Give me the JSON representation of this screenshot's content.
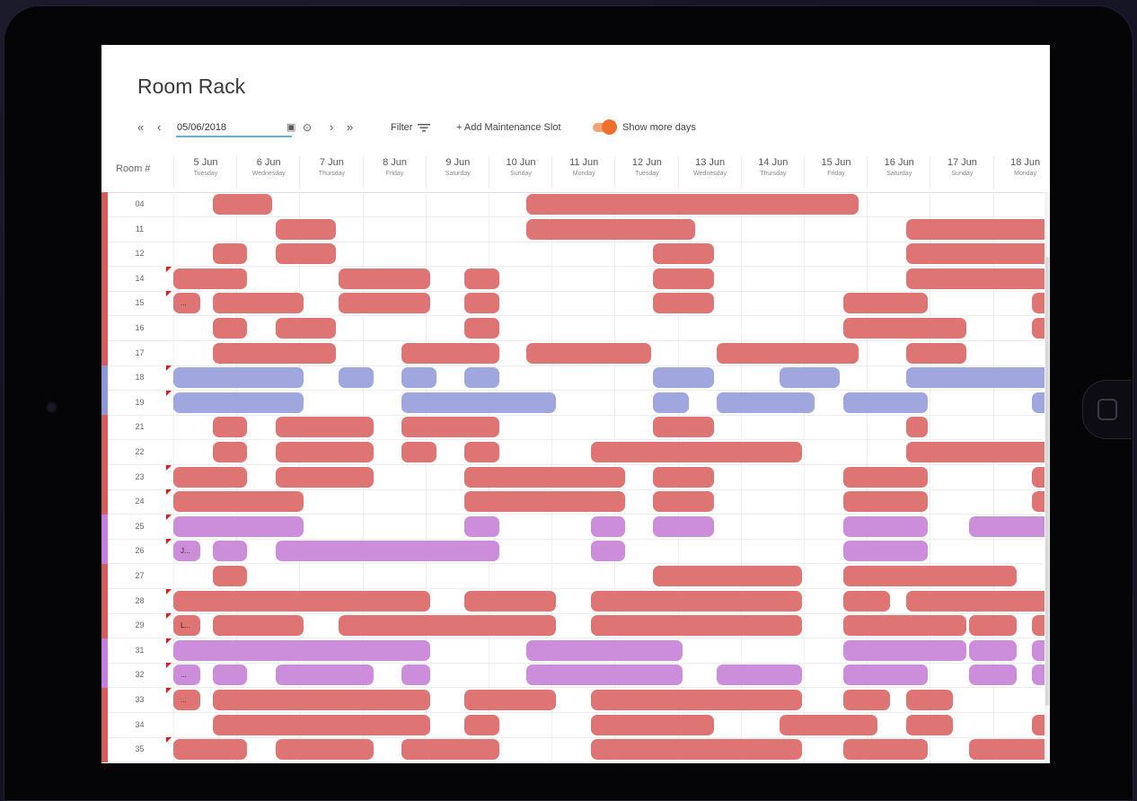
{
  "title": "Room Rack",
  "toolbar": {
    "first_icon": "«",
    "prev_icon": "‹",
    "date_value": "05/06/2018",
    "calendar_icon": "▣",
    "today_icon": "⊙",
    "next_icon": "›",
    "last_icon": "»",
    "filter_label": "Filter",
    "filter_icon": "filter-lines-icon",
    "add_label": "+ Add Maintenance Slot",
    "toggle_on": true,
    "toggle_label": "Show more days",
    "toggle_color": "#ef6f2c"
  },
  "table": {
    "room_header": "Room #",
    "days": [
      {
        "date": "5 Jun",
        "weekday": "Tuesday"
      },
      {
        "date": "6 Jun",
        "weekday": "Wednesday"
      },
      {
        "date": "7 Jun",
        "weekday": "Thursday"
      },
      {
        "date": "8 Jun",
        "weekday": "Friday"
      },
      {
        "date": "9 Jun",
        "weekday": "Saturday"
      },
      {
        "date": "10 Jun",
        "weekday": "Sunday"
      },
      {
        "date": "11 Jun",
        "weekday": "Monday"
      },
      {
        "date": "12 Jun",
        "weekday": "Tuesday"
      },
      {
        "date": "13 Jun",
        "weekday": "Wednesday"
      },
      {
        "date": "14 Jun",
        "weekday": "Thursday"
      },
      {
        "date": "15 Jun",
        "weekday": "Friday"
      },
      {
        "date": "16 Jun",
        "weekday": "Saturday"
      },
      {
        "date": "17 Jun",
        "weekday": "Sunday"
      },
      {
        "date": "18 Jun",
        "weekday": "Monday"
      }
    ]
  },
  "colors": {
    "red": "#df7474",
    "blue": "#a0a6de",
    "purple": "#cc8edb",
    "flag": "#e01a1a",
    "accent": "#5ab4d9"
  },
  "rooms": [
    {
      "no": "04",
      "type": "red",
      "flag": false,
      "bars": [
        [
          0.62,
          1.6
        ],
        [
          5.6,
          8.1
        ],
        [
          7.4,
          10.9
        ]
      ]
    },
    {
      "no": "11",
      "type": "red",
      "flag": false,
      "bars": [
        [
          1.62,
          2.6
        ],
        [
          5.6,
          8.3
        ],
        [
          11.62,
          14.1
        ]
      ]
    },
    {
      "no": "12",
      "type": "red",
      "flag": false,
      "bars": [
        [
          0.62,
          1.2
        ],
        [
          1.62,
          2.6
        ],
        [
          7.6,
          8.6
        ],
        [
          11.62,
          14.1
        ]
      ]
    },
    {
      "no": "14",
      "type": "red",
      "flag": true,
      "bars": [
        [
          0,
          1.2
        ],
        [
          2.62,
          4.1
        ],
        [
          4.62,
          5.2
        ],
        [
          7.6,
          8.6
        ],
        [
          11.62,
          14.1
        ]
      ]
    },
    {
      "no": "15",
      "type": "red",
      "flag": true,
      "bars": [
        [
          0,
          0.45,
          "..."
        ],
        [
          0.62,
          2.1
        ],
        [
          2.62,
          4.1
        ],
        [
          4.62,
          5.2
        ],
        [
          7.6,
          8.6
        ],
        [
          10.62,
          12.0
        ],
        [
          13.62,
          14.1
        ]
      ]
    },
    {
      "no": "16",
      "type": "red",
      "flag": false,
      "bars": [
        [
          0.62,
          1.2
        ],
        [
          1.62,
          2.6
        ],
        [
          4.62,
          5.2
        ],
        [
          10.62,
          12.6
        ],
        [
          13.62,
          14.1
        ]
      ]
    },
    {
      "no": "17",
      "type": "red",
      "flag": false,
      "bars": [
        [
          0.62,
          2.6
        ],
        [
          3.62,
          5.2
        ],
        [
          5.6,
          7.6
        ],
        [
          8.62,
          10.9
        ],
        [
          11.62,
          12.6
        ]
      ]
    },
    {
      "no": "18",
      "type": "blue",
      "flag": true,
      "bars": [
        [
          0,
          2.1
        ],
        [
          2.62,
          3.2
        ],
        [
          3.62,
          4.2
        ],
        [
          4.62,
          5.2
        ],
        [
          7.6,
          8.6
        ],
        [
          9.62,
          10.6
        ],
        [
          11.62,
          14.1
        ]
      ]
    },
    {
      "no": "19",
      "type": "blue",
      "flag": true,
      "bars": [
        [
          0,
          2.1
        ],
        [
          3.62,
          6.1
        ],
        [
          7.6,
          8.2
        ],
        [
          8.62,
          10.2
        ],
        [
          10.62,
          12.0
        ],
        [
          13.62,
          14.1
        ]
      ]
    },
    {
      "no": "21",
      "type": "red",
      "flag": false,
      "bars": [
        [
          0.62,
          1.2
        ],
        [
          1.62,
          3.2
        ],
        [
          3.62,
          5.2
        ],
        [
          7.6,
          8.6
        ],
        [
          11.62,
          12.0
        ]
      ]
    },
    {
      "no": "22",
      "type": "red",
      "flag": false,
      "bars": [
        [
          0.62,
          1.2
        ],
        [
          1.62,
          3.2
        ],
        [
          3.62,
          4.2
        ],
        [
          4.62,
          5.2
        ],
        [
          6.62,
          10.0
        ],
        [
          11.62,
          14.1
        ]
      ]
    },
    {
      "no": "23",
      "type": "red",
      "flag": true,
      "bars": [
        [
          0,
          1.2
        ],
        [
          1.62,
          3.2
        ],
        [
          4.62,
          7.2
        ],
        [
          7.6,
          8.6
        ],
        [
          10.62,
          12.0
        ],
        [
          13.62,
          14.1
        ]
      ]
    },
    {
      "no": "24",
      "type": "red",
      "flag": true,
      "bars": [
        [
          0,
          2.1
        ],
        [
          4.62,
          7.2
        ],
        [
          7.6,
          8.6
        ],
        [
          10.62,
          12.0
        ],
        [
          13.62,
          14.1
        ]
      ]
    },
    {
      "no": "25",
      "type": "purple",
      "flag": true,
      "bars": [
        [
          0,
          2.1
        ],
        [
          4.62,
          5.2
        ],
        [
          6.62,
          7.2
        ],
        [
          7.6,
          8.6
        ],
        [
          10.62,
          12.0
        ],
        [
          12.62,
          14.1
        ]
      ]
    },
    {
      "no": "26",
      "type": "purple",
      "flag": true,
      "bars": [
        [
          0,
          0.45,
          "J..."
        ],
        [
          0.62,
          1.2
        ],
        [
          1.62,
          5.2
        ],
        [
          6.62,
          7.2
        ],
        [
          10.62,
          12.0
        ]
      ]
    },
    {
      "no": "27",
      "type": "red",
      "flag": false,
      "bars": [
        [
          0.62,
          1.2
        ],
        [
          7.6,
          10.0
        ],
        [
          10.62,
          13.4
        ]
      ]
    },
    {
      "no": "28",
      "type": "red",
      "flag": true,
      "bars": [
        [
          0,
          4.1
        ],
        [
          4.62,
          6.1
        ],
        [
          6.62,
          10.0
        ],
        [
          10.62,
          11.4
        ],
        [
          11.62,
          14.1
        ]
      ]
    },
    {
      "no": "29",
      "type": "red",
      "flag": true,
      "bars": [
        [
          0,
          0.45,
          "L..."
        ],
        [
          0.62,
          2.1
        ],
        [
          2.62,
          6.1
        ],
        [
          6.62,
          10.0
        ],
        [
          10.62,
          12.6
        ],
        [
          12.62,
          13.4
        ],
        [
          13.62,
          14.1
        ]
      ]
    },
    {
      "no": "31",
      "type": "purple",
      "flag": true,
      "bars": [
        [
          0,
          4.1
        ],
        [
          5.6,
          8.1
        ],
        [
          10.62,
          12.6
        ],
        [
          12.62,
          13.4
        ],
        [
          13.62,
          14.1
        ]
      ]
    },
    {
      "no": "32",
      "type": "purple",
      "flag": true,
      "bars": [
        [
          0,
          0.45,
          "..."
        ],
        [
          0.62,
          1.2
        ],
        [
          1.62,
          3.2
        ],
        [
          3.62,
          4.1
        ],
        [
          5.6,
          8.1
        ],
        [
          8.62,
          10.0
        ],
        [
          10.62,
          12.0
        ],
        [
          12.62,
          13.4
        ],
        [
          13.62,
          14.1
        ]
      ]
    },
    {
      "no": "33",
      "type": "red",
      "flag": true,
      "bars": [
        [
          0,
          0.45,
          "..."
        ],
        [
          0.62,
          4.1
        ],
        [
          4.62,
          6.1
        ],
        [
          6.62,
          10.0
        ],
        [
          10.62,
          11.4
        ],
        [
          11.62,
          12.4
        ]
      ]
    },
    {
      "no": "34",
      "type": "red",
      "flag": false,
      "bars": [
        [
          0.62,
          4.1
        ],
        [
          4.62,
          5.2
        ],
        [
          6.62,
          8.6
        ],
        [
          9.62,
          11.2
        ],
        [
          11.62,
          12.4
        ],
        [
          13.62,
          14.1
        ]
      ]
    },
    {
      "no": "35",
      "type": "red",
      "flag": true,
      "bars": [
        [
          0,
          1.2
        ],
        [
          1.62,
          3.2
        ],
        [
          3.62,
          5.2
        ],
        [
          6.62,
          10.0
        ],
        [
          10.62,
          12.0
        ],
        [
          12.62,
          14.1
        ]
      ]
    }
  ]
}
